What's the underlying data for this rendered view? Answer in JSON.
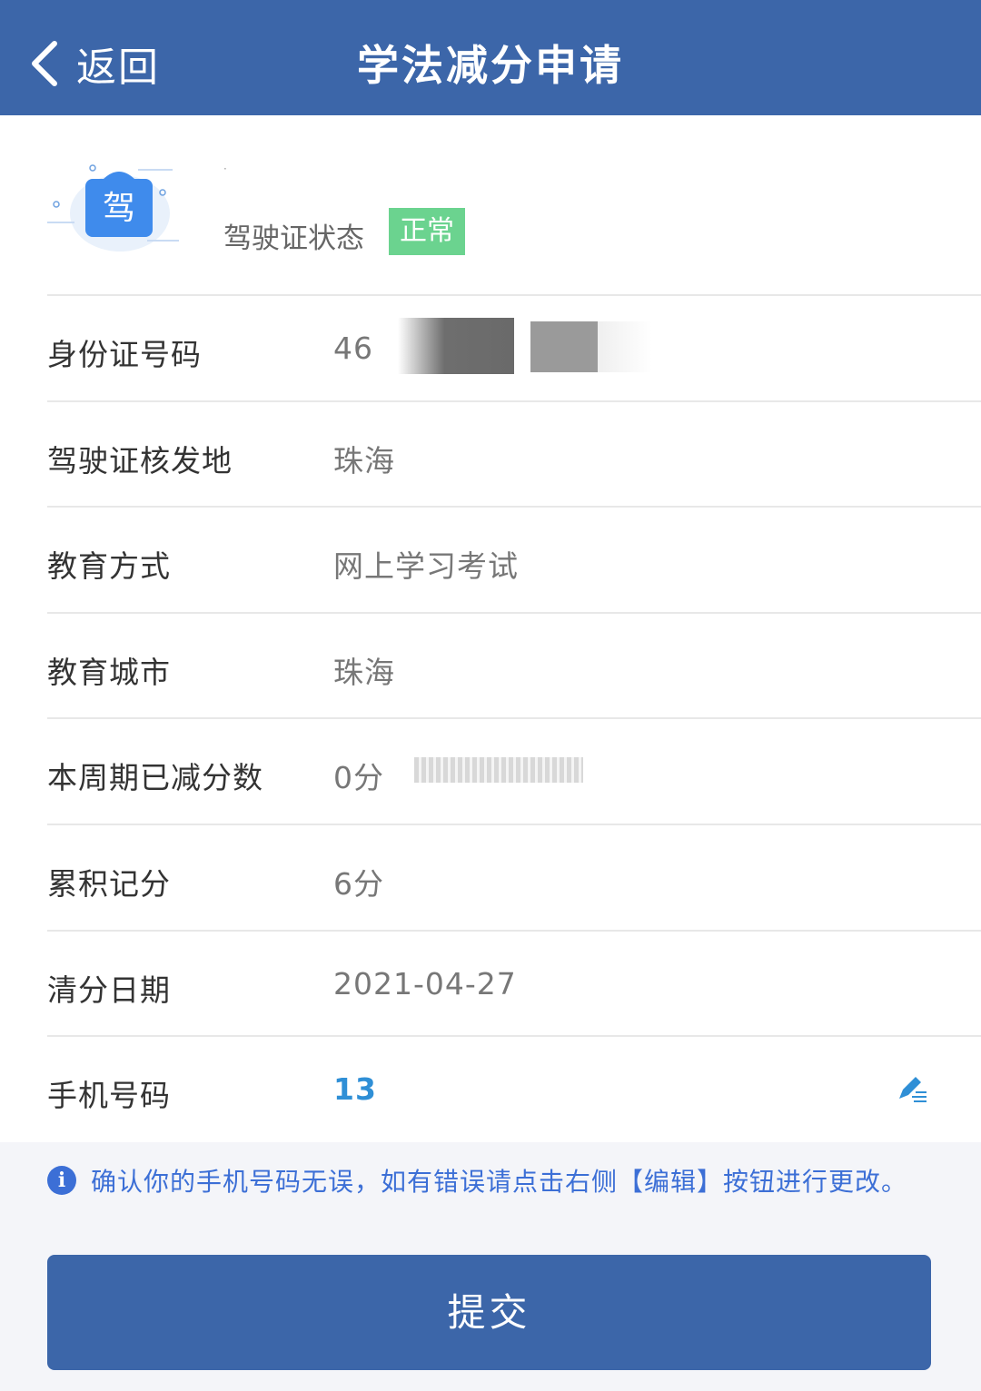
{
  "nav": {
    "back_label": "返回",
    "title": "学法减分申请"
  },
  "license": {
    "icon_char": "驾",
    "status_label": "驾驶证状态",
    "status_badge": "正常"
  },
  "rows": [
    {
      "label": "身份证号码",
      "value": "46"
    },
    {
      "label": "驾驶证核发地",
      "value": "珠海"
    },
    {
      "label": "教育方式",
      "value": "网上学习考试"
    },
    {
      "label": "教育城市",
      "value": "珠海"
    },
    {
      "label": "本周期已减分数",
      "value": "0分"
    },
    {
      "label": "累积记分",
      "value": "6分"
    },
    {
      "label": "清分日期",
      "value": "2021-04-27"
    },
    {
      "label": "手机号码",
      "value": "13"
    }
  ],
  "notice": {
    "text": "确认你的手机号码无误，如有错误请点击右侧【编辑】按钮进行更改。"
  },
  "submit_label": "提交",
  "colors": {
    "primary": "#3c66a9",
    "status_green": "#6bd38f",
    "link_blue": "#2f8fd6",
    "notice_blue": "#3c6fd6"
  }
}
